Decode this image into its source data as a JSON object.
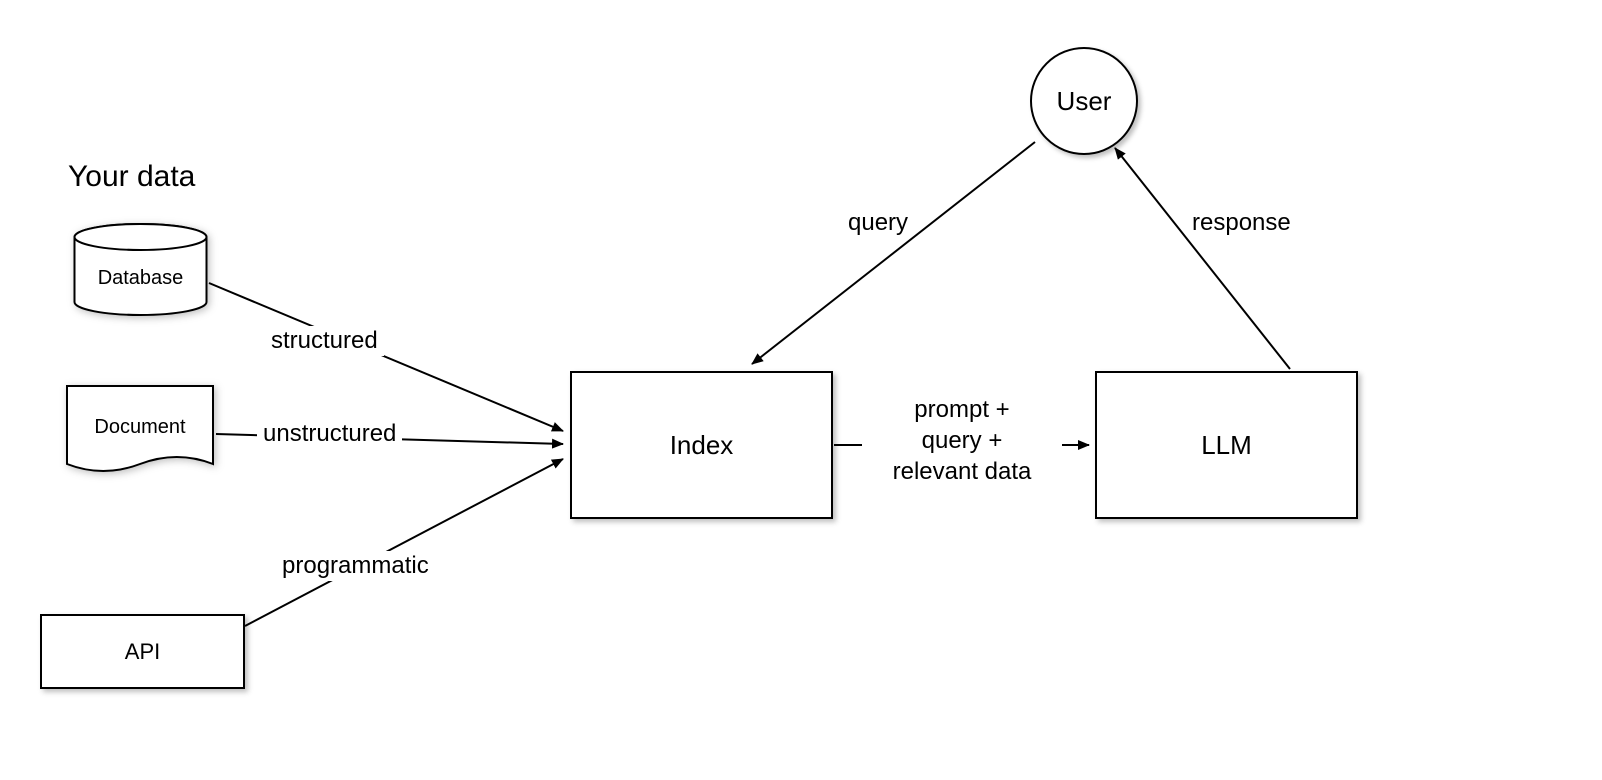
{
  "header": {
    "title": "Your data"
  },
  "sources": {
    "database": {
      "label": "Database",
      "edge_label": "structured"
    },
    "document": {
      "label": "Document",
      "edge_label": "unstructured"
    },
    "api": {
      "label": "API",
      "edge_label": "programmatic"
    }
  },
  "nodes": {
    "index": {
      "label": "Index"
    },
    "llm": {
      "label": "LLM"
    },
    "user": {
      "label": "User"
    }
  },
  "edges": {
    "user_to_index": {
      "label": "query"
    },
    "index_to_llm": {
      "label": "prompt +\nquery +\nrelevant data"
    },
    "llm_to_user": {
      "label": "response"
    }
  }
}
